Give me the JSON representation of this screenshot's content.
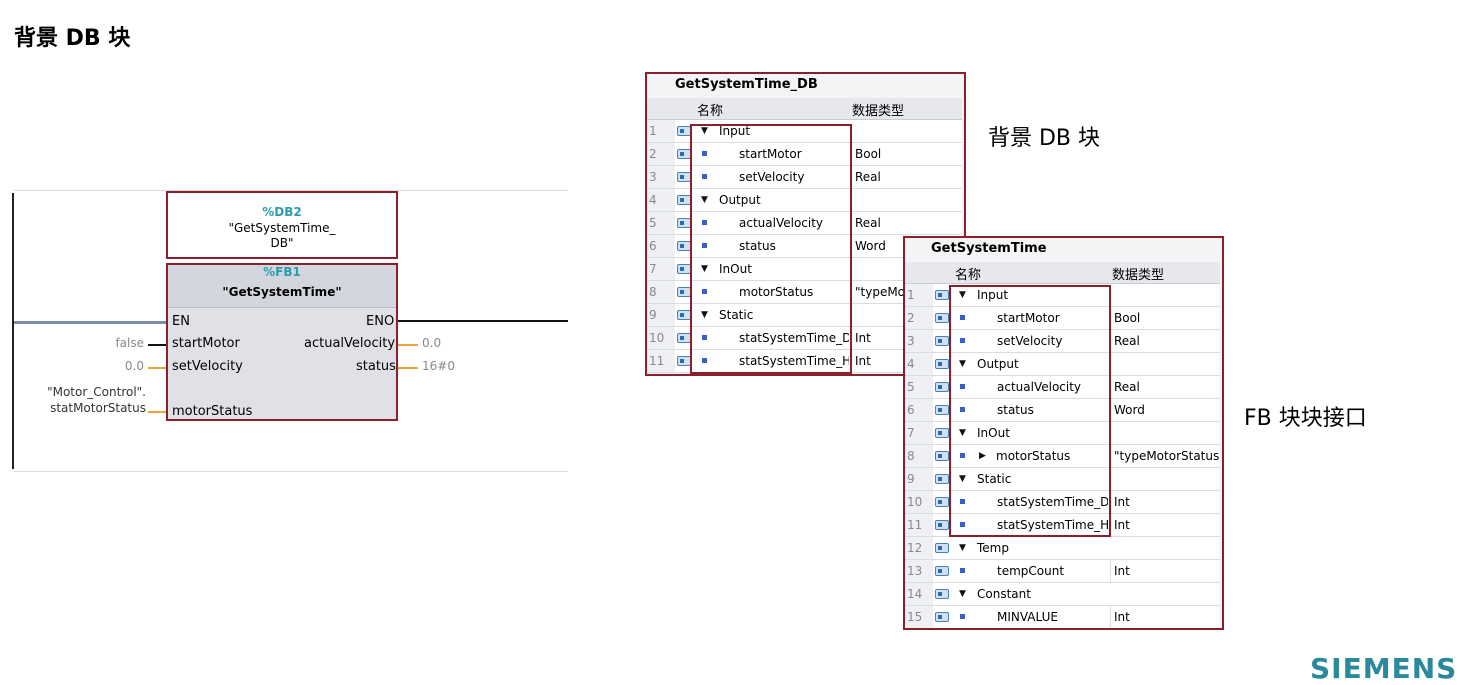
{
  "page_title": "背景 DB 块",
  "callouts": {
    "instance_db": "背景 DB 块",
    "fb_interface": "FB 块块接口"
  },
  "network": {
    "db_address": "%DB2",
    "db_name_line1": "\"GetSystemTime_",
    "db_name_line2": "DB\"",
    "fb_address": "%FB1",
    "fb_name": "\"GetSystemTime\"",
    "pins_left": [
      "EN",
      "startMotor",
      "setVelocity",
      "motorStatus"
    ],
    "pins_right": [
      "ENO",
      "actualVelocity",
      "status"
    ],
    "operand_start": "false",
    "operand_velocity": "0.0",
    "operand_motor_line1": "\"Motor_Control\".",
    "operand_motor_line2": "statMotorStatus",
    "output_velocity": "0.0",
    "output_status": "16#0"
  },
  "db_table": {
    "title": "GetSystemTime_DB",
    "col_name": "名称",
    "col_type": "数据类型",
    "rows": [
      {
        "num": "1",
        "name": "Input",
        "type": "",
        "section": true
      },
      {
        "num": "2",
        "name": "startMotor",
        "type": "Bool",
        "section": false
      },
      {
        "num": "3",
        "name": "setVelocity",
        "type": "Real",
        "section": false
      },
      {
        "num": "4",
        "name": "Output",
        "type": "",
        "section": true
      },
      {
        "num": "5",
        "name": "actualVelocity",
        "type": "Real",
        "section": false
      },
      {
        "num": "6",
        "name": "status",
        "type": "Word",
        "section": false
      },
      {
        "num": "7",
        "name": "InOut",
        "type": "",
        "section": true
      },
      {
        "num": "8",
        "name": "motorStatus",
        "type": "\"typeMo",
        "section": false
      },
      {
        "num": "9",
        "name": "Static",
        "type": "",
        "section": true
      },
      {
        "num": "10",
        "name": "statSystemTime_D",
        "type": "Int",
        "section": false
      },
      {
        "num": "11",
        "name": "statSystemTime_H",
        "type": "Int",
        "section": false
      }
    ]
  },
  "fb_table": {
    "title": "GetSystemTime",
    "col_name": "名称",
    "col_type": "数据类型",
    "rows": [
      {
        "num": "1",
        "name": "Input",
        "type": "",
        "section": true
      },
      {
        "num": "2",
        "name": "startMotor",
        "type": "Bool",
        "section": false
      },
      {
        "num": "3",
        "name": "setVelocity",
        "type": "Real",
        "section": false
      },
      {
        "num": "4",
        "name": "Output",
        "type": "",
        "section": true
      },
      {
        "num": "5",
        "name": "actualVelocity",
        "type": "Real",
        "section": false
      },
      {
        "num": "6",
        "name": "status",
        "type": "Word",
        "section": false
      },
      {
        "num": "7",
        "name": "InOut",
        "type": "",
        "section": true
      },
      {
        "num": "8",
        "name": "motorStatus",
        "type": "\"typeMotorStatus\"",
        "section": false,
        "expandable": true
      },
      {
        "num": "9",
        "name": "Static",
        "type": "",
        "section": true
      },
      {
        "num": "10",
        "name": "statSystemTime_D",
        "type": "Int",
        "section": false
      },
      {
        "num": "11",
        "name": "statSystemTime_H",
        "type": "Int",
        "section": false
      },
      {
        "num": "12",
        "name": "Temp",
        "type": "",
        "section": true
      },
      {
        "num": "13",
        "name": "tempCount",
        "type": "Int",
        "section": false
      },
      {
        "num": "14",
        "name": "Constant",
        "type": "",
        "section": true
      },
      {
        "num": "15",
        "name": "MINVALUE",
        "type": "Int",
        "section": false
      }
    ]
  },
  "logo": "SIEMENS",
  "colors": {
    "highlight_frame": "#8c1f2b",
    "address_teal": "#2b9cab",
    "output_wire": "#f2a23c"
  }
}
